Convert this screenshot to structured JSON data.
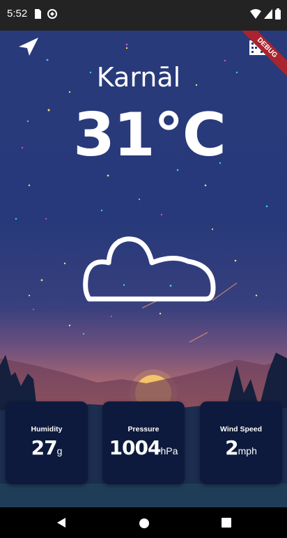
{
  "status_bar": {
    "time": "5:52"
  },
  "weather": {
    "city": "Karnāl",
    "temperature": "31°C",
    "condition_icon": "cloud-icon"
  },
  "debug_banner": "DEBUG",
  "cards": [
    {
      "label": "Humidity",
      "value": "27",
      "unit": "g"
    },
    {
      "label": "Pressure",
      "value": "1004",
      "unit": "hPa"
    },
    {
      "label": "Wind Speed",
      "value": "2",
      "unit": "mph"
    }
  ],
  "colors": {
    "sky_top": "#283a7a",
    "sunset": "#cf7e63",
    "card_bg": "#0d1a3d"
  }
}
